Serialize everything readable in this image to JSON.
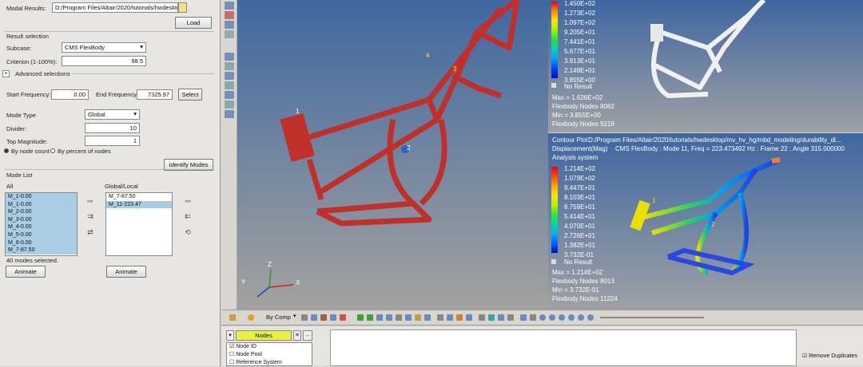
{
  "panel": {
    "modal_results_label": "Modal Results:",
    "modal_results_path": "D:/Program Files/Altair/2020/tutorials/hwdesktop/mv",
    "load": "Load",
    "result_selection": "Result selection",
    "subcase_label": "Subcase:",
    "subcase_value": "CMS FlexBody",
    "criterion_label": "Criterion (1-100%):",
    "criterion_value": "98.5",
    "advanced": "Advanced selections",
    "start_freq_label": "Start Frequency:",
    "start_freq": "0.00",
    "end_freq_label": "End Frequency:",
    "end_freq": "7325.97",
    "select": "Select",
    "mode_type_label": "Mode Type",
    "mode_type": "Global",
    "divider_label": "Divider:",
    "divider": "10",
    "top_mag_label": "Top Magnitude:",
    "top_mag": "1",
    "by_node_count": "By node count",
    "by_percent": "By percent of nodes",
    "identify": "Identify Modes",
    "mode_list": "Mode List",
    "all": "All",
    "global_local": "Global/Local",
    "all_modes": [
      "M_1-0.00",
      "M_1-0.00",
      "M_2-0.00",
      "M_3-0.00",
      "M_4-0.00",
      "M_5-0.00",
      "M_6-0.00",
      "M_7-87.50"
    ],
    "global_modes": [
      "M_7-87.50",
      "M_11-223.47"
    ],
    "selected_count": "40 modes selected.",
    "animate": "Animate",
    "animate2": "Animate"
  },
  "main": {
    "node_labels": [
      "1",
      "2",
      "3",
      "4"
    ],
    "axis_x": "X",
    "axis_y": "Y",
    "axis_z": "Z"
  },
  "top_view": {
    "legend": [
      "1.450E+02",
      "1.273E+02",
      "1.097E+02",
      "9.205E+01",
      "7.441E+01",
      "5.677E+01",
      "3.913E+01",
      "2.149E+01",
      "3.855E+00"
    ],
    "no_result": "No Result",
    "max": "Max = 1.626E+02",
    "max_node": "Flexbody Nodes 8082",
    "min": "Min = 3.855E+00",
    "min_node": "Flexbody Nodes 9219"
  },
  "bottom_view": {
    "contour_plot": "Contour Plot",
    "path": "D:/Program Files/Altair/2020/tutorials/hwdesktop/mv_hv_hg/mbd_modeling/durability_di...",
    "result": "Displacement(Mag)",
    "subcase": "CMS FlexBody : Mode 11, Freq = 223.473492 Hz : Frame 22 : Angle 315.000000",
    "analysis": "Analysis system",
    "legend": [
      "1.214E+02",
      "1.079E+02",
      "9.447E+01",
      "8.103E+01",
      "6.759E+01",
      "5.414E+01",
      "4.070E+01",
      "2.726E+01",
      "1.382E+01",
      "3.732E-01"
    ],
    "no_result": "No Result",
    "max": "Max = 1.214E+02",
    "max_node": "Flexbody Nodes 8013",
    "min": "Min = 3.732E-01",
    "min_node": "Flexbody Nodes 11224",
    "node_labels": [
      "1",
      "2"
    ]
  },
  "toolbar": {
    "by_comp": "By Comp"
  },
  "bottom": {
    "nodes": "Nodes",
    "node_id": "Node ID",
    "node_pool": "Node Pool",
    "ref_system": "Reference System",
    "remove_dup": "Remove Duplicates",
    "ellipsis": "..."
  },
  "colors": {
    "frame": "#c0302a",
    "legend": [
      "#e8001a",
      "#ff4a00",
      "#ffa600",
      "#ffe600",
      "#b8f000",
      "#30e830",
      "#00d8a0",
      "#00b4e8",
      "#0060ff",
      "#0010c0"
    ]
  }
}
